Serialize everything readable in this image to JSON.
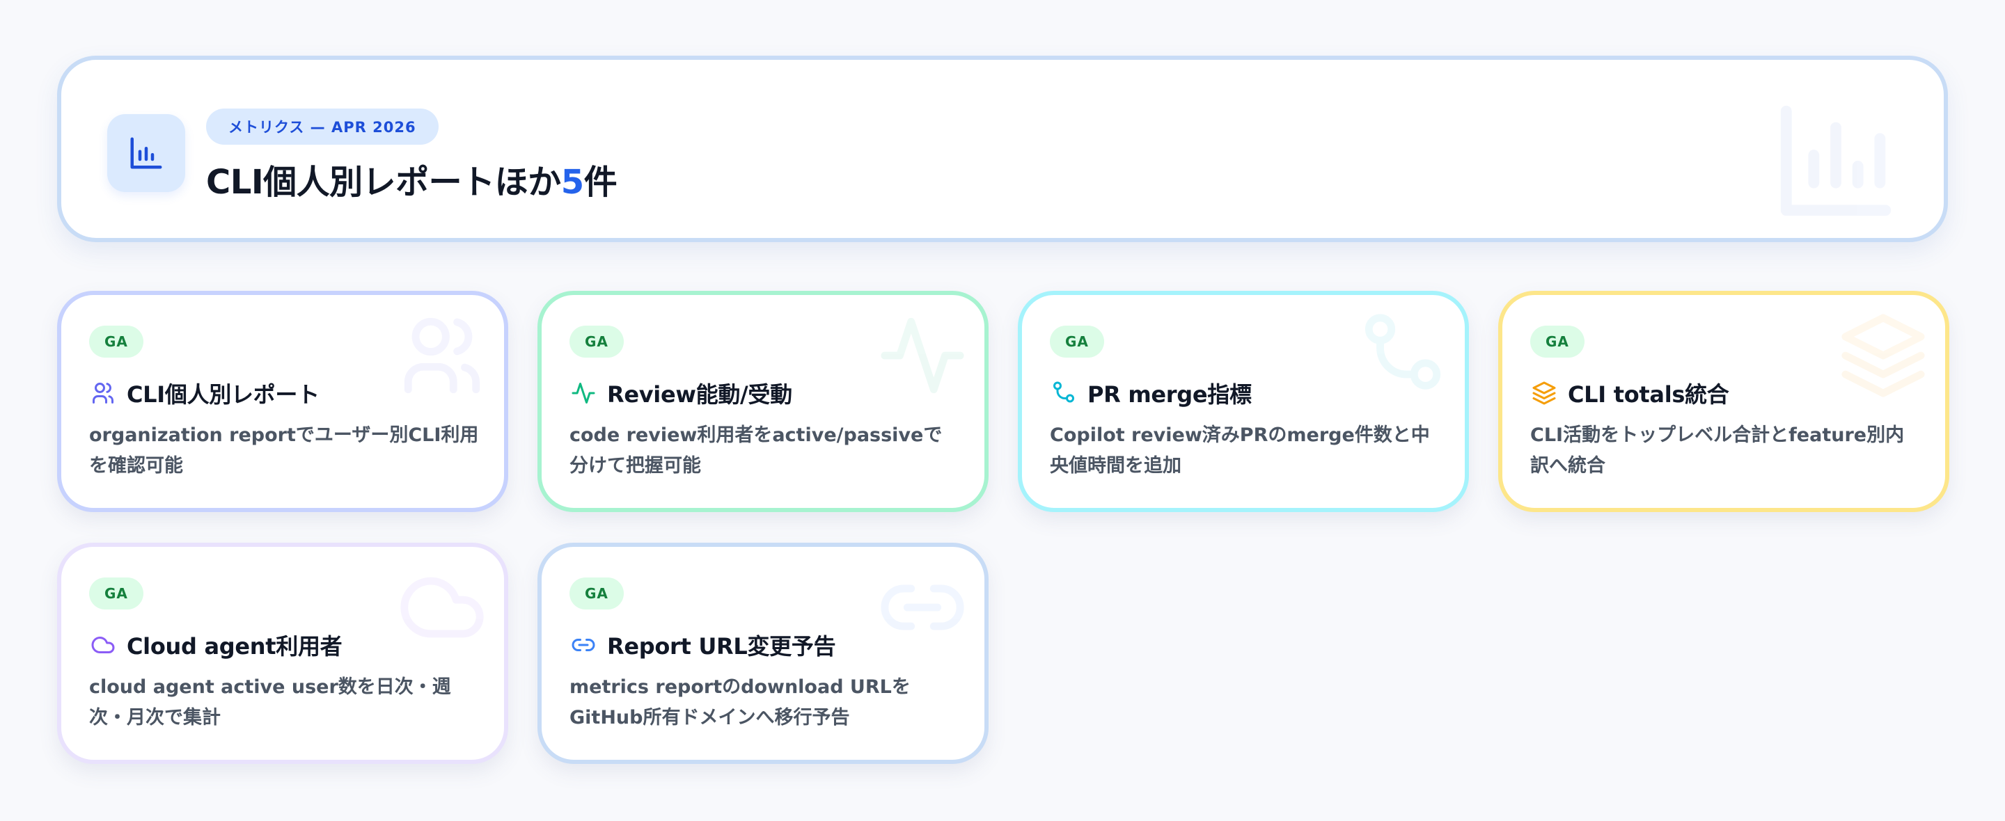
{
  "header": {
    "pill": "メトリクス — APR 2026",
    "title_prefix": "CLI個人別レポートほか",
    "title_count": "5",
    "title_suffix": "件",
    "icon": "bar-chart-icon"
  },
  "cards": [
    {
      "badge": "GA",
      "icon": "users-icon",
      "title": "CLI個人別レポート",
      "description": "organization reportでユーザー別CLI利用を確認可能",
      "accent": "#6366f1"
    },
    {
      "badge": "GA",
      "icon": "activity-icon",
      "title": "Review能動/受動",
      "description": "code review利用者をactive/passiveで分けて把握可能",
      "accent": "#10b981"
    },
    {
      "badge": "GA",
      "icon": "git-merge-icon",
      "title": "PR merge指標",
      "description": "Copilot review済みPRのmerge件数と中央値時間を追加",
      "accent": "#06b6d4"
    },
    {
      "badge": "GA",
      "icon": "layers-icon",
      "title": "CLI totals統合",
      "description": "CLI活動をトップレベル合計とfeature別内訳へ統合",
      "accent": "#f59e0b"
    },
    {
      "badge": "GA",
      "icon": "cloud-icon",
      "title": "Cloud agent利用者",
      "description": "cloud agent active user数を日次・週次・月次で集計",
      "accent": "#8b5cf6"
    },
    {
      "badge": "GA",
      "icon": "link-icon",
      "title": "Report URL変更予告",
      "description": "metrics reportのdownload URLをGitHub所有ドメインへ移行予告",
      "accent": "#3b82f6"
    }
  ]
}
